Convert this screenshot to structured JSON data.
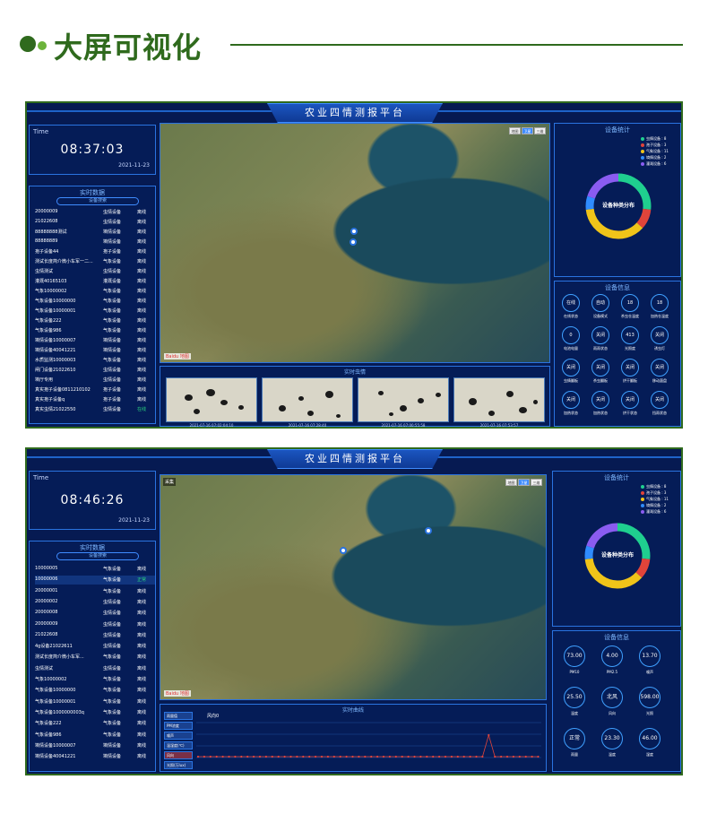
{
  "header": {
    "title": "大屏可视化"
  },
  "platform_title": "农业四情测报平台",
  "map_buttons": [
    "地图",
    "卫星",
    "三维"
  ],
  "baidu_logo": "Baidu 地图",
  "caiji_label": "采集",
  "screen1": {
    "time_label": "Time",
    "time": "08:37:03",
    "date": "2021-11-23",
    "realtime_title": "实时数据",
    "search_placeholder": "设备搜索",
    "rows": [
      [
        "20000009",
        "虫情设备",
        "离线"
      ],
      [
        "21022608",
        "虫情设备",
        "离线"
      ],
      [
        "88888888测试",
        "墒情设备",
        "离线"
      ],
      [
        "88888889",
        "墒情设备",
        "离线"
      ],
      [
        "孢子设备44",
        "孢子设备",
        "离线"
      ],
      [
        "测试长度简介微小车军一二...",
        "气象设备",
        "离线"
      ],
      [
        "虫情测试",
        "虫情设备",
        "离线"
      ],
      [
        "灌溉40165103",
        "灌溉设备",
        "离线"
      ],
      [
        "气象10000002",
        "气象设备",
        "离线"
      ],
      [
        "气象设备10000000",
        "气象设备",
        "离线"
      ],
      [
        "气象设备10000001",
        "气象设备",
        "离线"
      ],
      [
        "气象设备222",
        "气象设备",
        "离线"
      ],
      [
        "气象设备986",
        "气象设备",
        "离线"
      ],
      [
        "墒情设备10000007",
        "墒情设备",
        "离线"
      ],
      [
        "墒情设备40041221",
        "墒情设备",
        "离线"
      ],
      [
        "水质监测10000003",
        "气象设备",
        "离线"
      ],
      [
        "闸门设备21022610",
        "虫情设备",
        "离线"
      ],
      [
        "墒厅专用",
        "虫情设备",
        "离线"
      ],
      [
        "真实孢子设备0811210102",
        "孢子设备",
        "离线"
      ],
      [
        "真实孢子设备q",
        "孢子设备",
        "离线"
      ],
      [
        "真实虫情21022550",
        "虫情设备",
        "在线"
      ]
    ],
    "photos_title": "实时虫情",
    "photo_captions": [
      "2021-07-16 07:02:04:10",
      "2021-07-16 07:28:40",
      "2021-07-16 07:00:55:58",
      "2021-07-16 07:53:57"
    ],
    "stats_title": "设备统计",
    "donut_label": "设备种类分布",
    "legend": [
      {
        "name": "虫情设备",
        "count": "8",
        "color": "#1fcf8f"
      },
      {
        "name": "孢子设备",
        "count": "3",
        "color": "#e0443a"
      },
      {
        "name": "气象设备",
        "count": "11",
        "color": "#f0c419"
      },
      {
        "name": "墒情设备",
        "count": "2",
        "color": "#2f8cff"
      },
      {
        "name": "灌溉设备",
        "count": "6",
        "color": "#8a5cf0"
      }
    ],
    "info_title": "设备信息",
    "info_cells": [
      [
        "在线",
        "在线状态"
      ],
      [
        "自动",
        "设备模式"
      ],
      [
        "18",
        "杀虫仓温度"
      ],
      [
        "18",
        "加热仓温度"
      ],
      [
        "0",
        "电池电量"
      ],
      [
        "关闭",
        "雨雨状态"
      ],
      [
        "413",
        "光照度"
      ],
      [
        "关闭",
        "诱虫灯"
      ],
      [
        "关闭",
        "虫情翻板"
      ],
      [
        "关闭",
        "杀虫翻板"
      ],
      [
        "关闭",
        "烘干翻板"
      ],
      [
        "关闭",
        "移动菌盘"
      ],
      [
        "关闭",
        "加热状态"
      ],
      [
        "关闭",
        "加热状态"
      ],
      [
        "关闭",
        "烘干状态"
      ],
      [
        "关闭",
        "挡雨状态"
      ]
    ]
  },
  "screen2": {
    "time_label": "Time",
    "time": "08:46:26",
    "date": "2021-11-23",
    "realtime_title": "实时数据",
    "search_placeholder": "设备搜索",
    "rows": [
      [
        "10000005",
        "气象设备",
        "离线"
      ],
      [
        "10000006",
        "气象设备",
        "正常"
      ],
      [
        "20000001",
        "气象设备",
        "离线"
      ],
      [
        "20000002",
        "虫情设备",
        "离线"
      ],
      [
        "20000008",
        "虫情设备",
        "离线"
      ],
      [
        "20000009",
        "虫情设备",
        "离线"
      ],
      [
        "21022608",
        "虫情设备",
        "离线"
      ],
      [
        "4g设备21022611",
        "虫情设备",
        "离线"
      ],
      [
        "测试长度简介微小车军...",
        "气象设备",
        "离线"
      ],
      [
        "虫情测试",
        "虫情设备",
        "离线"
      ],
      [
        "气象10000002",
        "气象设备",
        "离线"
      ],
      [
        "气象设备10000000",
        "气象设备",
        "离线"
      ],
      [
        "气象设备10000001",
        "气象设备",
        "离线"
      ],
      [
        "气象设备1000000003q",
        "气象设备",
        "离线"
      ],
      [
        "气象设备222",
        "气象设备",
        "离线"
      ],
      [
        "气象设备986",
        "气象设备",
        "离线"
      ],
      [
        "墒情设备10000007",
        "墒情设备",
        "离线"
      ],
      [
        "墒情设备40041221",
        "墒情设备",
        "离线"
      ]
    ],
    "curve_title": "实时曲线",
    "curve_tabs": [
      "雨量值",
      "PM浓度",
      "噪声",
      "温湿度(℃)",
      "风向",
      "光照(万lux)"
    ],
    "curve_legend": "风向0",
    "stats_title": "设备统计",
    "donut_label": "设备种类分布",
    "legend": [
      {
        "name": "虫情设备",
        "count": "8",
        "color": "#1fcf8f"
      },
      {
        "name": "孢子设备",
        "count": "3",
        "color": "#e0443a"
      },
      {
        "name": "气象设备",
        "count": "11",
        "color": "#f0c419"
      },
      {
        "name": "墒情设备",
        "count": "2",
        "color": "#2f8cff"
      },
      {
        "name": "灌溉设备",
        "count": "6",
        "color": "#8a5cf0"
      }
    ],
    "info_title": "设备信息",
    "info_cells": [
      [
        "73.00",
        "PM10"
      ],
      [
        "4.00",
        "PM2.5"
      ],
      [
        "13.70",
        "噪声"
      ],
      [
        "25.50",
        "温度"
      ],
      [
        "北风",
        "风向"
      ],
      [
        "598.00",
        "光照"
      ],
      [
        "正常",
        "雨量"
      ],
      [
        "23.30",
        "温度"
      ],
      [
        "46.00",
        "湿度"
      ]
    ]
  }
}
